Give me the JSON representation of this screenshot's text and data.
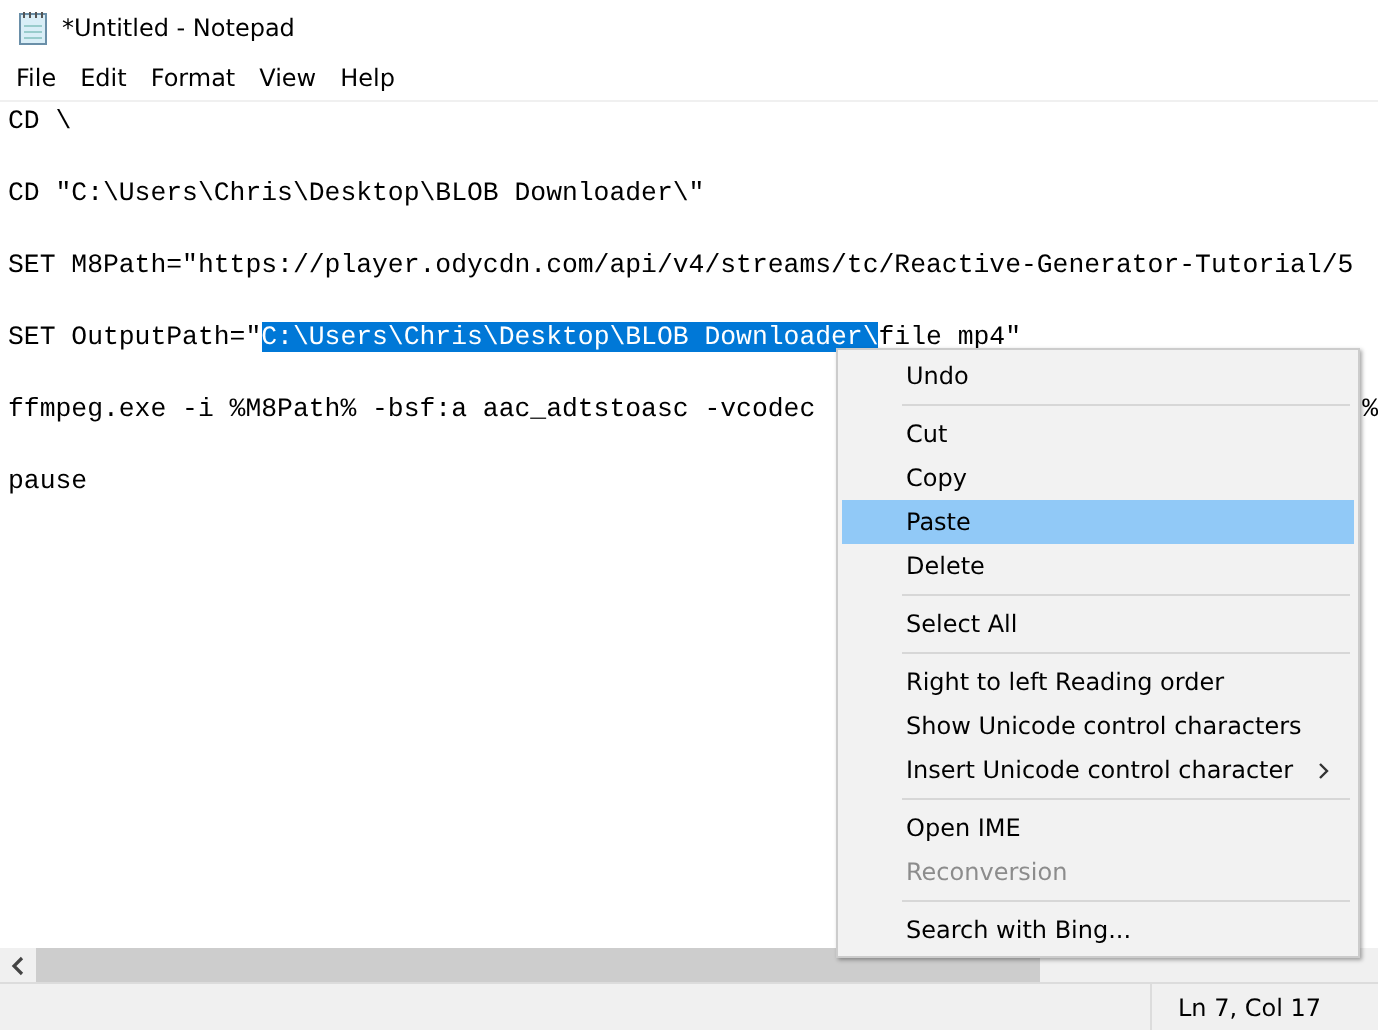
{
  "window": {
    "title": "*Untitled - Notepad"
  },
  "menu_bar": [
    "File",
    "Edit",
    "Format",
    "View",
    "Help"
  ],
  "editor": {
    "lines": [
      {
        "segments": [
          {
            "kind": "text",
            "text": "CD \\"
          }
        ]
      },
      {
        "segments": [
          {
            "kind": "text",
            "text": "CD \"C:\\Users\\Chris\\Desktop\\BLOB Downloader\\\""
          }
        ]
      },
      {
        "segments": [
          {
            "kind": "text",
            "text": "SET M8Path=\"https://player.odycdn.com/api/v4/streams/tc/Reactive-Generator-Tutorial/5"
          }
        ]
      },
      {
        "segments": [
          {
            "kind": "text",
            "text": "SET OutputPath=\""
          },
          {
            "kind": "selected",
            "text": "C:\\Users\\Chris\\Desktop\\BLOB Downloader\\"
          },
          {
            "kind": "text",
            "text": "file mp4\""
          }
        ]
      },
      {
        "segments": [
          {
            "kind": "text",
            "text": "ffmpeg.exe -i %M8Path% -bsf:a aac_adtstoasc -vcodec"
          },
          {
            "kind": "tail",
            "text": "%"
          }
        ]
      },
      {
        "segments": [
          {
            "kind": "text",
            "text": "pause"
          }
        ]
      }
    ]
  },
  "context_menu": {
    "items": [
      {
        "kind": "item",
        "label": "Undo",
        "selected": false,
        "disabled": false
      },
      {
        "kind": "separator"
      },
      {
        "kind": "item",
        "label": "Cut",
        "selected": false,
        "disabled": false
      },
      {
        "kind": "item",
        "label": "Copy",
        "selected": false,
        "disabled": false
      },
      {
        "kind": "item",
        "label": "Paste",
        "selected": true,
        "disabled": false
      },
      {
        "kind": "item",
        "label": "Delete",
        "selected": false,
        "disabled": false
      },
      {
        "kind": "separator"
      },
      {
        "kind": "item",
        "label": "Select All",
        "selected": false,
        "disabled": false
      },
      {
        "kind": "separator"
      },
      {
        "kind": "item",
        "label": "Right to left Reading order",
        "selected": false,
        "disabled": false
      },
      {
        "kind": "item",
        "label": "Show Unicode control characters",
        "selected": false,
        "disabled": false
      },
      {
        "kind": "submenu",
        "label": "Insert Unicode control character",
        "selected": false,
        "disabled": false
      },
      {
        "kind": "separator"
      },
      {
        "kind": "item",
        "label": "Open IME",
        "selected": false,
        "disabled": false
      },
      {
        "kind": "item",
        "label": "Reconversion",
        "selected": false,
        "disabled": true
      },
      {
        "kind": "separator"
      },
      {
        "kind": "item",
        "label": "Search with Bing...",
        "selected": false,
        "disabled": false
      }
    ]
  },
  "status_bar": {
    "position": "Ln 7, Col 17"
  }
}
